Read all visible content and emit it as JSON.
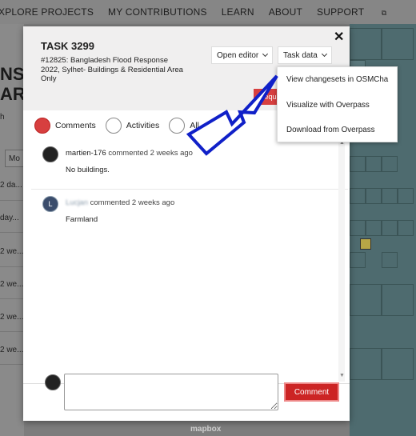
{
  "nav": {
    "items": [
      "XPLORE PROJECTS",
      "MY CONTRIBUTIONS",
      "LEARN",
      "ABOUT",
      "SUPPORT"
    ],
    "support_icon": "external-link-icon"
  },
  "background": {
    "title_lines": [
      "NSE",
      "ARE"
    ],
    "side_char": "h",
    "filter_label": "Mo",
    "rows": [
      "2 da...",
      "day...",
      "2 we...",
      "2 we...",
      "2 we...",
      "2 we...",
      "2 we..."
    ],
    "map_attribution": "mapbox"
  },
  "modal": {
    "task_title": "TASK 3299",
    "project_name": "#12825: Bangladesh Flood Response 2022, Sylhet- Buildings & Residential Area Only",
    "open_editor_label": "Open editor",
    "task_data_label": "Task data",
    "request_label": "Requ",
    "close_icon": "close-icon",
    "tabs": [
      {
        "label": "Comments",
        "selected": true
      },
      {
        "label": "Activities",
        "selected": false
      },
      {
        "label": "All",
        "selected": false
      }
    ],
    "comments": [
      {
        "user": "martien-176",
        "action": "commented 2 weeks ago",
        "text": "No buildings."
      },
      {
        "user": "Lucjan",
        "action": "commented 2 weeks ago",
        "text": "Farmland"
      }
    ],
    "comment_button_label": "Comment",
    "textarea_placeholder": ""
  },
  "task_data_menu": {
    "items": [
      "View changesets in OSMCha",
      "Visualize with Overpass",
      "Download from Overpass"
    ]
  },
  "colors": {
    "accent": "#d73f3f",
    "arrow": "#1020c8"
  }
}
